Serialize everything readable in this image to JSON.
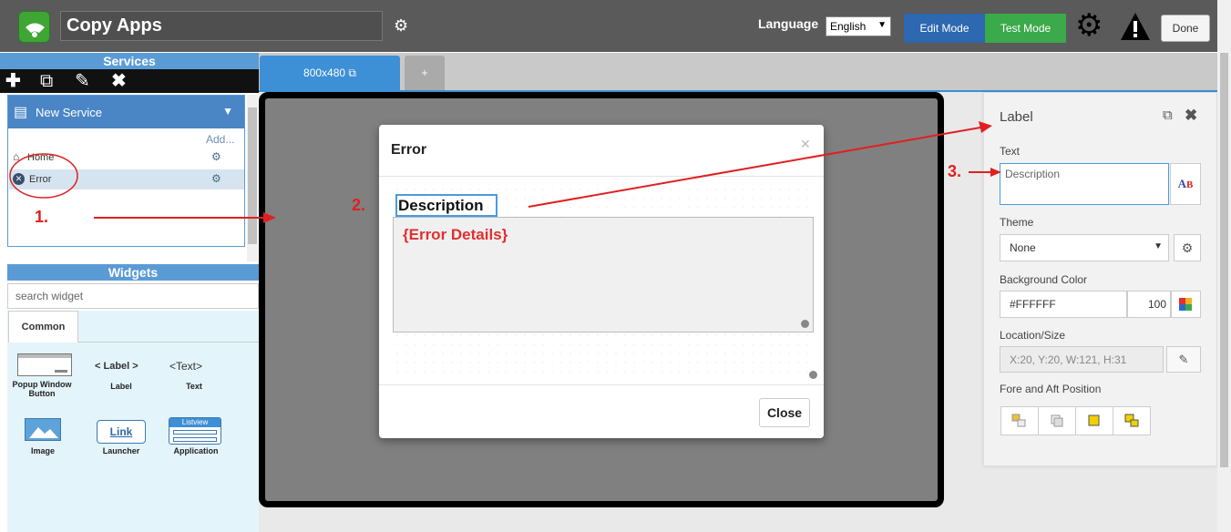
{
  "header": {
    "app_title": "Copy Apps",
    "language_label": "Language",
    "language_value": "English",
    "edit_mode": "Edit Mode",
    "test_mode": "Test Mode",
    "done": "Done"
  },
  "services": {
    "title": "Services",
    "group": "New Service",
    "add": "Add...",
    "items": [
      {
        "label": "Home"
      },
      {
        "label": "Error"
      }
    ]
  },
  "widgets": {
    "title": "Widgets",
    "search_placeholder": "search widget",
    "tab": "Common",
    "items": [
      {
        "label": "Popup Window Button"
      },
      {
        "label": "Label",
        "preview": "< Label >"
      },
      {
        "label": "Text",
        "preview": "<Text>"
      },
      {
        "label": "Image"
      },
      {
        "label": "Launcher",
        "preview": "Link"
      },
      {
        "label": "Application",
        "preview": "Listview"
      }
    ]
  },
  "canvas": {
    "tab_label": "800x480",
    "add_tab": "+"
  },
  "dialog": {
    "title": "Error",
    "description": "Description",
    "details": "{Error Details}",
    "close": "Close"
  },
  "properties": {
    "title": "Label",
    "text_label": "Text",
    "text_value": "Description",
    "theme_label": "Theme",
    "theme_value": "None",
    "bg_label": "Background Color",
    "bg_value": "#FFFFFF",
    "opacity": "100",
    "loc_label": "Location/Size",
    "loc_value": "X:20, Y:20, W:121, H:31",
    "fore_label": "Fore and Aft Position"
  },
  "annotations": {
    "step1": "1.",
    "step2": "2.",
    "step3": "3."
  },
  "colors": {
    "accent_blue": "#2d68b0",
    "test_green": "#3aaa4a",
    "annotation_red": "#e02020"
  }
}
